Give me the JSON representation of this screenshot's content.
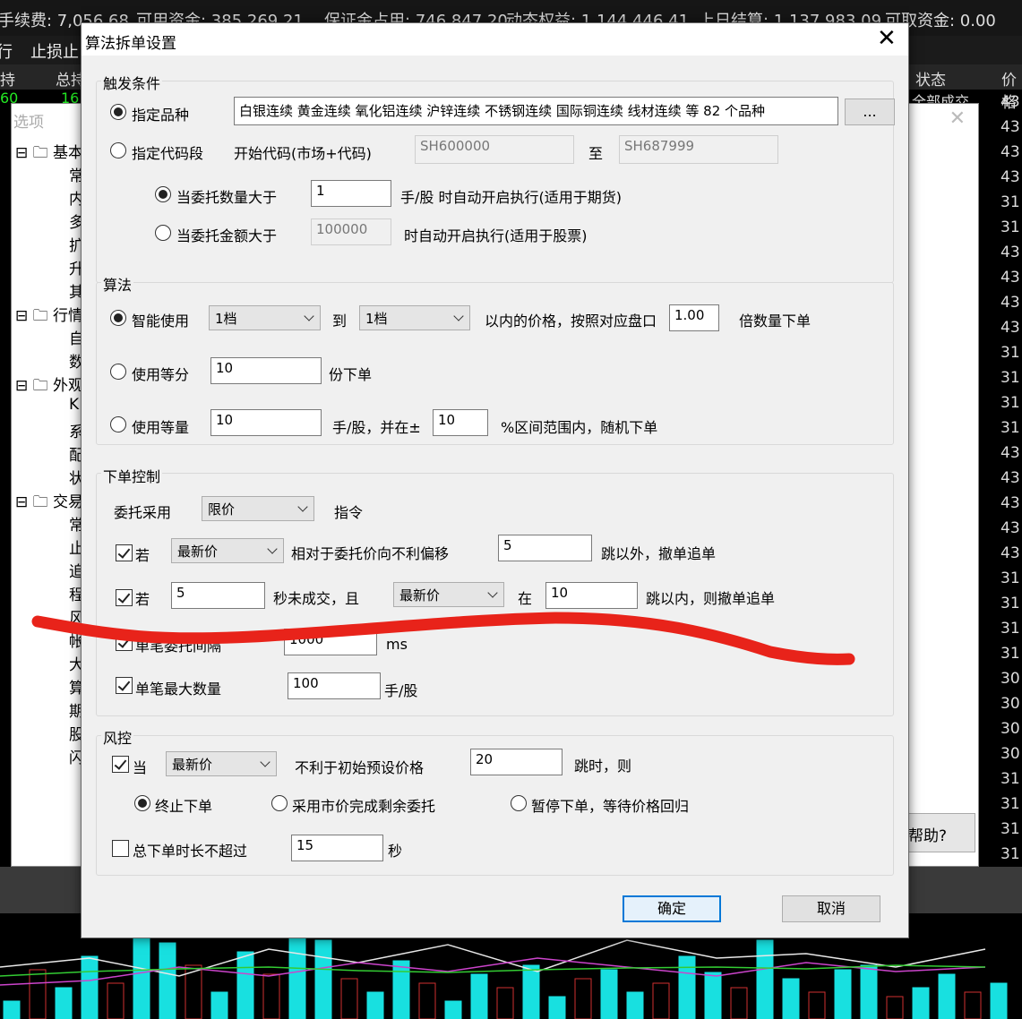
{
  "topbar": {
    "fee": "手续费: 7,056.68",
    "available": "可用资金: 385,269.21",
    "margin": "保证金占用: 746,847.20",
    "equity": "动态权益: 1,144,446.41",
    "settle": "上日结算: 1,137,983.09",
    "withdraw": "可取资金: 0.00"
  },
  "toolbar": {
    "left_glyph": "行",
    "stoploss": "止损止"
  },
  "table_header": {
    "hold": "持",
    "total": "总持",
    "status": "状态",
    "price": "价格"
  },
  "table_row": {
    "left": "60",
    "total": "16",
    "status": "全部成交"
  },
  "price_column": [
    "43",
    "43",
    "43",
    "43",
    "31",
    "31",
    "43",
    "43",
    "43",
    "43",
    "31",
    "31",
    "31",
    "31",
    "43",
    "43",
    "43",
    "43",
    "43",
    "31",
    "31",
    "31",
    "31",
    "30",
    "30",
    "30",
    "30",
    "31",
    "31",
    "31",
    "31"
  ],
  "options_window": {
    "title": "选项",
    "help_button": "帮助?",
    "tree": {
      "basic": "基本",
      "basic_items": [
        "常",
        "内",
        "多",
        "扩",
        "升",
        "其"
      ],
      "market": "行情",
      "market_items": [
        "自",
        "数"
      ],
      "appearance": "外观",
      "appearance_items": [
        "K",
        "系",
        "配",
        "状"
      ],
      "trade": "交易",
      "trade_items": [
        "常",
        "止",
        "追",
        "程",
        "风",
        "帐",
        "大",
        "算",
        "期",
        "股",
        "闪"
      ]
    }
  },
  "dialog": {
    "title": "算法拆单设置",
    "trigger": {
      "legend": "触发条件",
      "specify_product": "指定品种",
      "products_text": "白银连续 黄金连续 氧化铝连续 沪锌连续 不锈钢连续 国际铜连续 线材连续 等 82 个品种",
      "browse_button": "...",
      "specify_code_range": "指定代码段",
      "start_code_label": "开始代码(市场+代码)",
      "start_code": "SH600000",
      "to_label": "至",
      "end_code": "SH687999",
      "qty_greater": "当委托数量大于",
      "qty_value": "1",
      "qty_suffix": "手/股 时自动开启执行(适用于期货)",
      "amount_greater": "当委托金额大于",
      "amount_value": "100000",
      "amount_suffix": "时自动开启执行(适用于股票)"
    },
    "algo": {
      "legend": "算法",
      "smart": "智能使用",
      "level_from": "1档",
      "to_label": "到",
      "level_to": "1档",
      "price_text": "以内的价格，按照对应盘口",
      "multiplier": "1.00",
      "multiplier_suffix": "倍数量下单",
      "equal_parts": "使用等分",
      "parts_value": "10",
      "parts_suffix": "份下单",
      "equal_qty": "使用等量",
      "qty_value": "10",
      "qty_mid": "手/股，并在±",
      "range_value": "10",
      "range_suffix": "%区间范围内，随机下单"
    },
    "order_control": {
      "legend": "下单控制",
      "order_using": "委托采用",
      "order_type": "限价",
      "instruction": "指令",
      "if1_label": "若",
      "if1_price": "最新价",
      "if1_text": "相对于委托价向不利偏移",
      "if1_ticks": "5",
      "if1_suffix": "跳以外，撤单追单",
      "if2_label": "若",
      "if2_seconds": "5",
      "if2_text": "秒未成交，且",
      "if2_price": "最新价",
      "if2_at": "在",
      "if2_ticks": "10",
      "if2_suffix": "跳以内，则撤单追单",
      "interval_label": "单笔委托间隔",
      "interval_value": "1000",
      "interval_unit": "ms",
      "max_qty_label": "单笔最大数量",
      "max_qty_value": "100",
      "max_qty_unit": "手/股"
    },
    "risk": {
      "legend": "风控",
      "when_label": "当",
      "price_type": "最新价",
      "text": "不利于初始预设价格",
      "ticks": "20",
      "ticks_suffix": "跳时，则",
      "stop_order": "终止下单",
      "market_fill": "采用市价完成剩余委托",
      "pause_order": "暂停下单，等待价格回归",
      "total_time_label": "总下单时长不超过",
      "total_time_value": "15",
      "total_time_unit": "秒"
    },
    "ok_button": "确定",
    "cancel_button": "取消"
  },
  "colors": {
    "accent_button_border": "#0078d7",
    "annotation_stroke": "#e8231a",
    "chart_bar": "#18e0e0"
  }
}
